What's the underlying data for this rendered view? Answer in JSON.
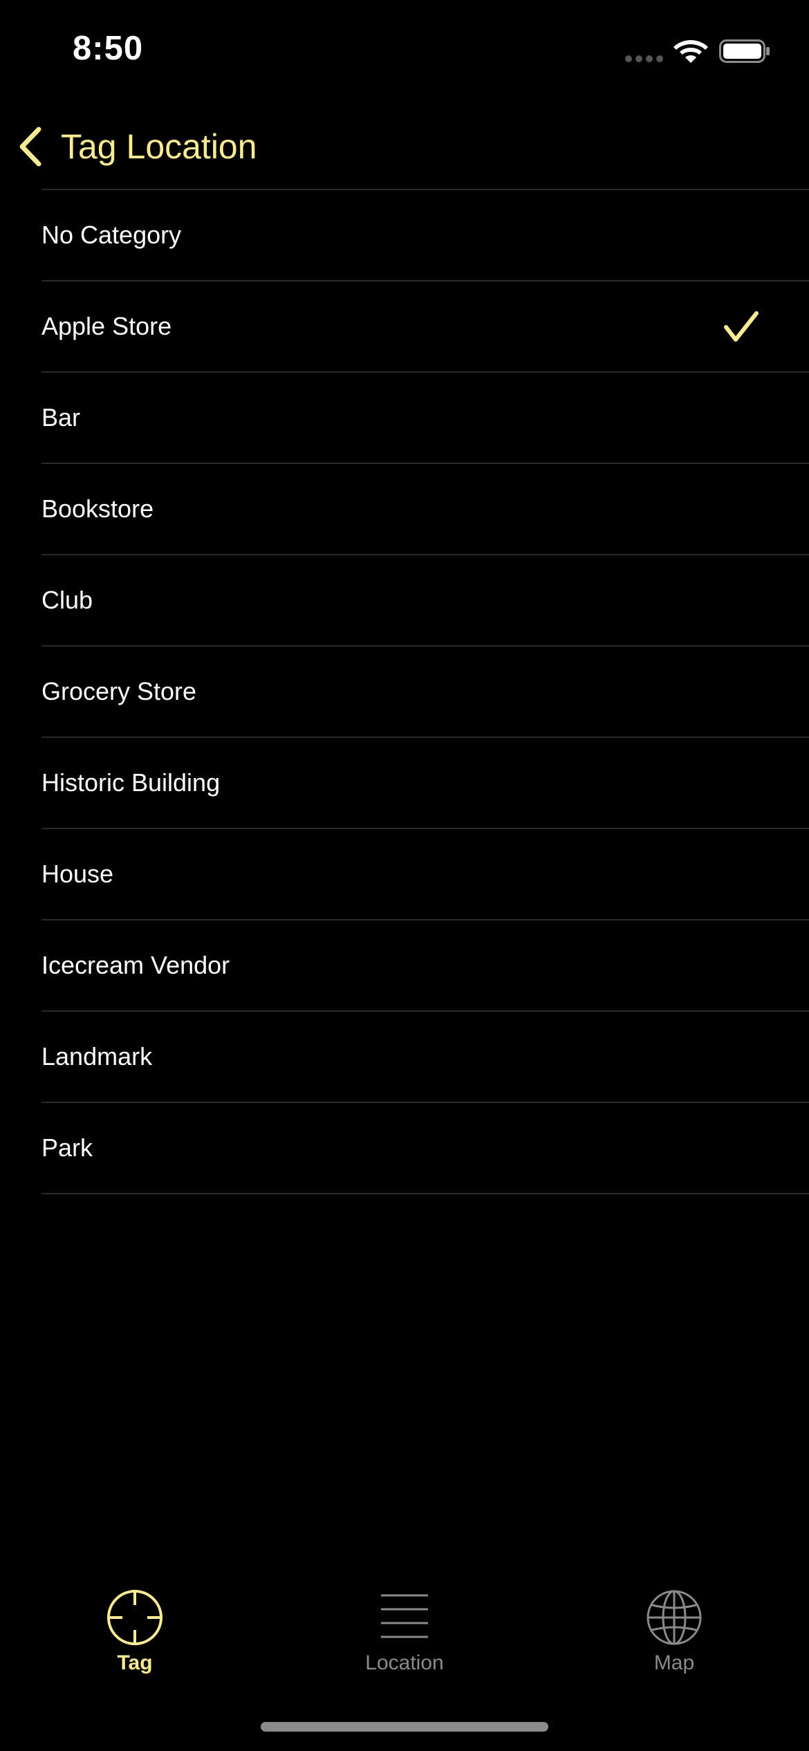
{
  "status_bar": {
    "time": "8:50",
    "signal_icon": "cellular-signal-icon",
    "wifi_icon": "wifi-icon",
    "battery_icon": "battery-icon"
  },
  "nav": {
    "back_icon": "chevron-left-icon",
    "title": "Tag Location"
  },
  "categories": [
    {
      "label": "No Category",
      "selected": false
    },
    {
      "label": "Apple Store",
      "selected": true
    },
    {
      "label": "Bar",
      "selected": false
    },
    {
      "label": "Bookstore",
      "selected": false
    },
    {
      "label": "Club",
      "selected": false
    },
    {
      "label": "Grocery Store",
      "selected": false
    },
    {
      "label": "Historic Building",
      "selected": false
    },
    {
      "label": "House",
      "selected": false
    },
    {
      "label": "Icecream Vendor",
      "selected": false
    },
    {
      "label": "Landmark",
      "selected": false
    },
    {
      "label": "Park",
      "selected": false
    }
  ],
  "selected_icon": "checkmark-icon",
  "tabs": [
    {
      "label": "Tag",
      "icon": "crosshair-icon",
      "active": true
    },
    {
      "label": "Location",
      "icon": "list-lines-icon",
      "active": false
    },
    {
      "label": "Map",
      "icon": "globe-icon",
      "active": false
    }
  ],
  "colors": {
    "accent": "#fdeb94",
    "background": "#000000",
    "text": "#ffffff",
    "separator": "#2a2a2a",
    "tab_inactive": "#8a8a8e"
  }
}
